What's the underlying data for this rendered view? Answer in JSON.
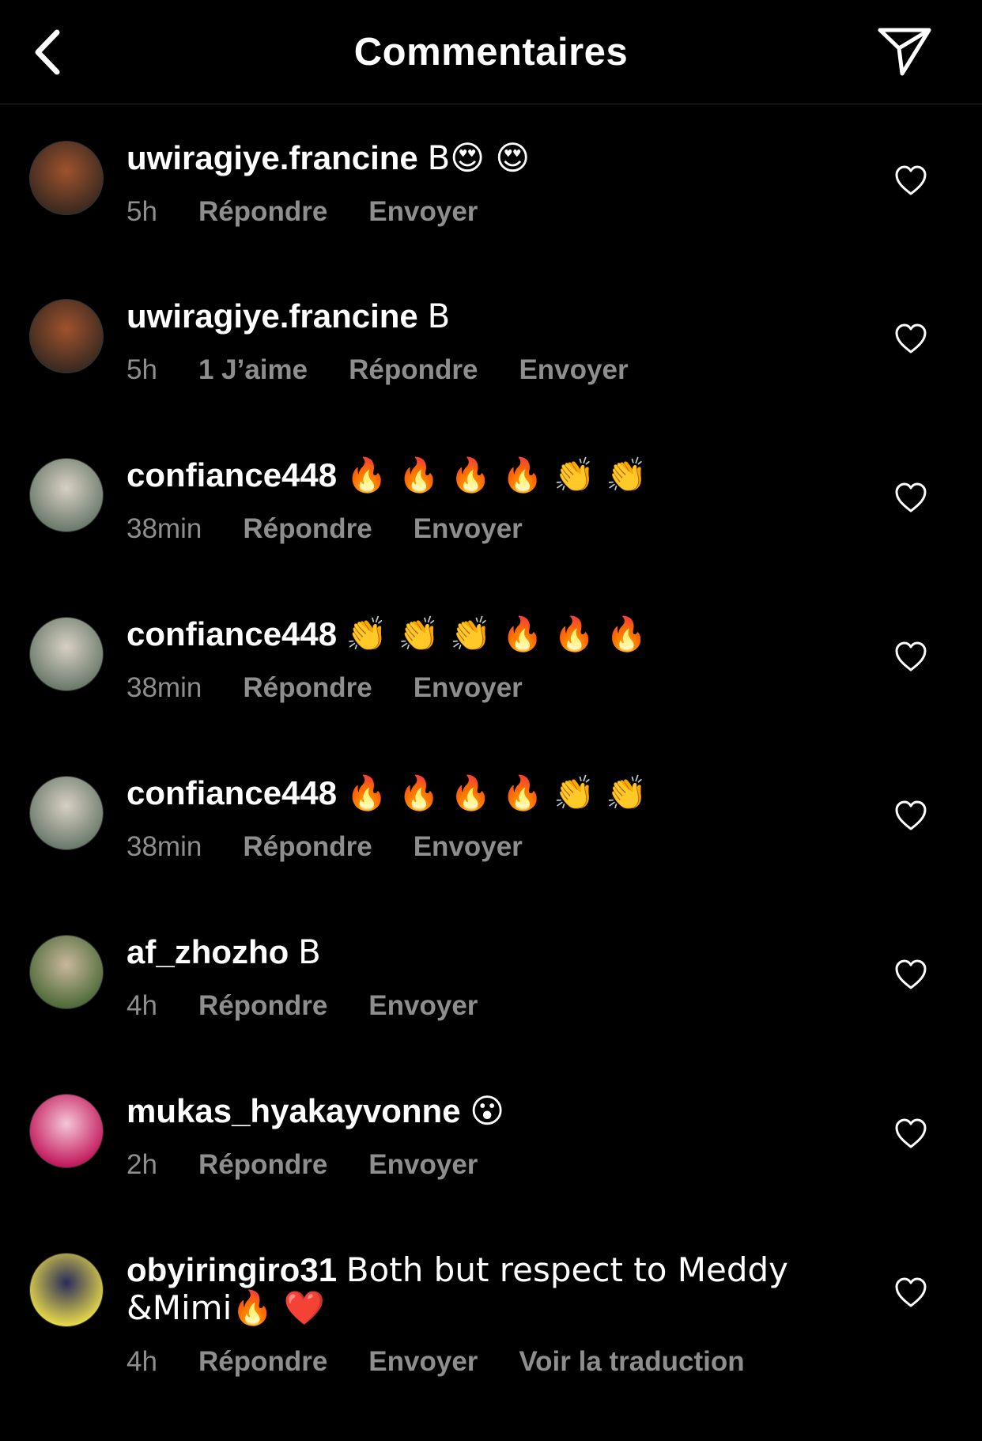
{
  "header": {
    "title": "Commentaires"
  },
  "comments": [
    {
      "username": "uwiragiye.francine",
      "text": "B😍 😍",
      "time": "5h",
      "likes": "",
      "reply": "Répondre",
      "send": "Envoyer",
      "translate": ""
    },
    {
      "username": "uwiragiye.francine",
      "text": "B",
      "time": "5h",
      "likes": "1 J’aime",
      "reply": "Répondre",
      "send": "Envoyer",
      "translate": ""
    },
    {
      "username": "confiance448",
      "text": "🔥 🔥 🔥 🔥 👏 👏",
      "time": "38min",
      "likes": "",
      "reply": "Répondre",
      "send": "Envoyer",
      "translate": ""
    },
    {
      "username": "confiance448",
      "text": "👏 👏 👏 🔥 🔥 🔥",
      "time": "38min",
      "likes": "",
      "reply": "Répondre",
      "send": "Envoyer",
      "translate": ""
    },
    {
      "username": "confiance448",
      "text": "🔥 🔥 🔥 🔥 👏 👏",
      "time": "38min",
      "likes": "",
      "reply": "Répondre",
      "send": "Envoyer",
      "translate": ""
    },
    {
      "username": "af_zhozho",
      "text": "B",
      "time": "4h",
      "likes": "",
      "reply": "Répondre",
      "send": "Envoyer",
      "translate": ""
    },
    {
      "username": "mukas_hyakayvonne",
      "text": "😮",
      "time": "2h",
      "likes": "",
      "reply": "Répondre",
      "send": "Envoyer",
      "translate": ""
    },
    {
      "username": "obyiringiro31",
      "text": "Both but respect to Meddy &Mimi🔥 ❤️",
      "time": "4h",
      "likes": "",
      "reply": "Répondre",
      "send": "Envoyer",
      "translate": "Voir la traduction"
    }
  ],
  "icons": {
    "back": "chevron-left-icon",
    "share": "paper-plane-icon",
    "like": "heart-outline-icon"
  },
  "colors": {
    "background": "#000000",
    "text": "#ffffff",
    "secondary": "#8e8e8e"
  }
}
